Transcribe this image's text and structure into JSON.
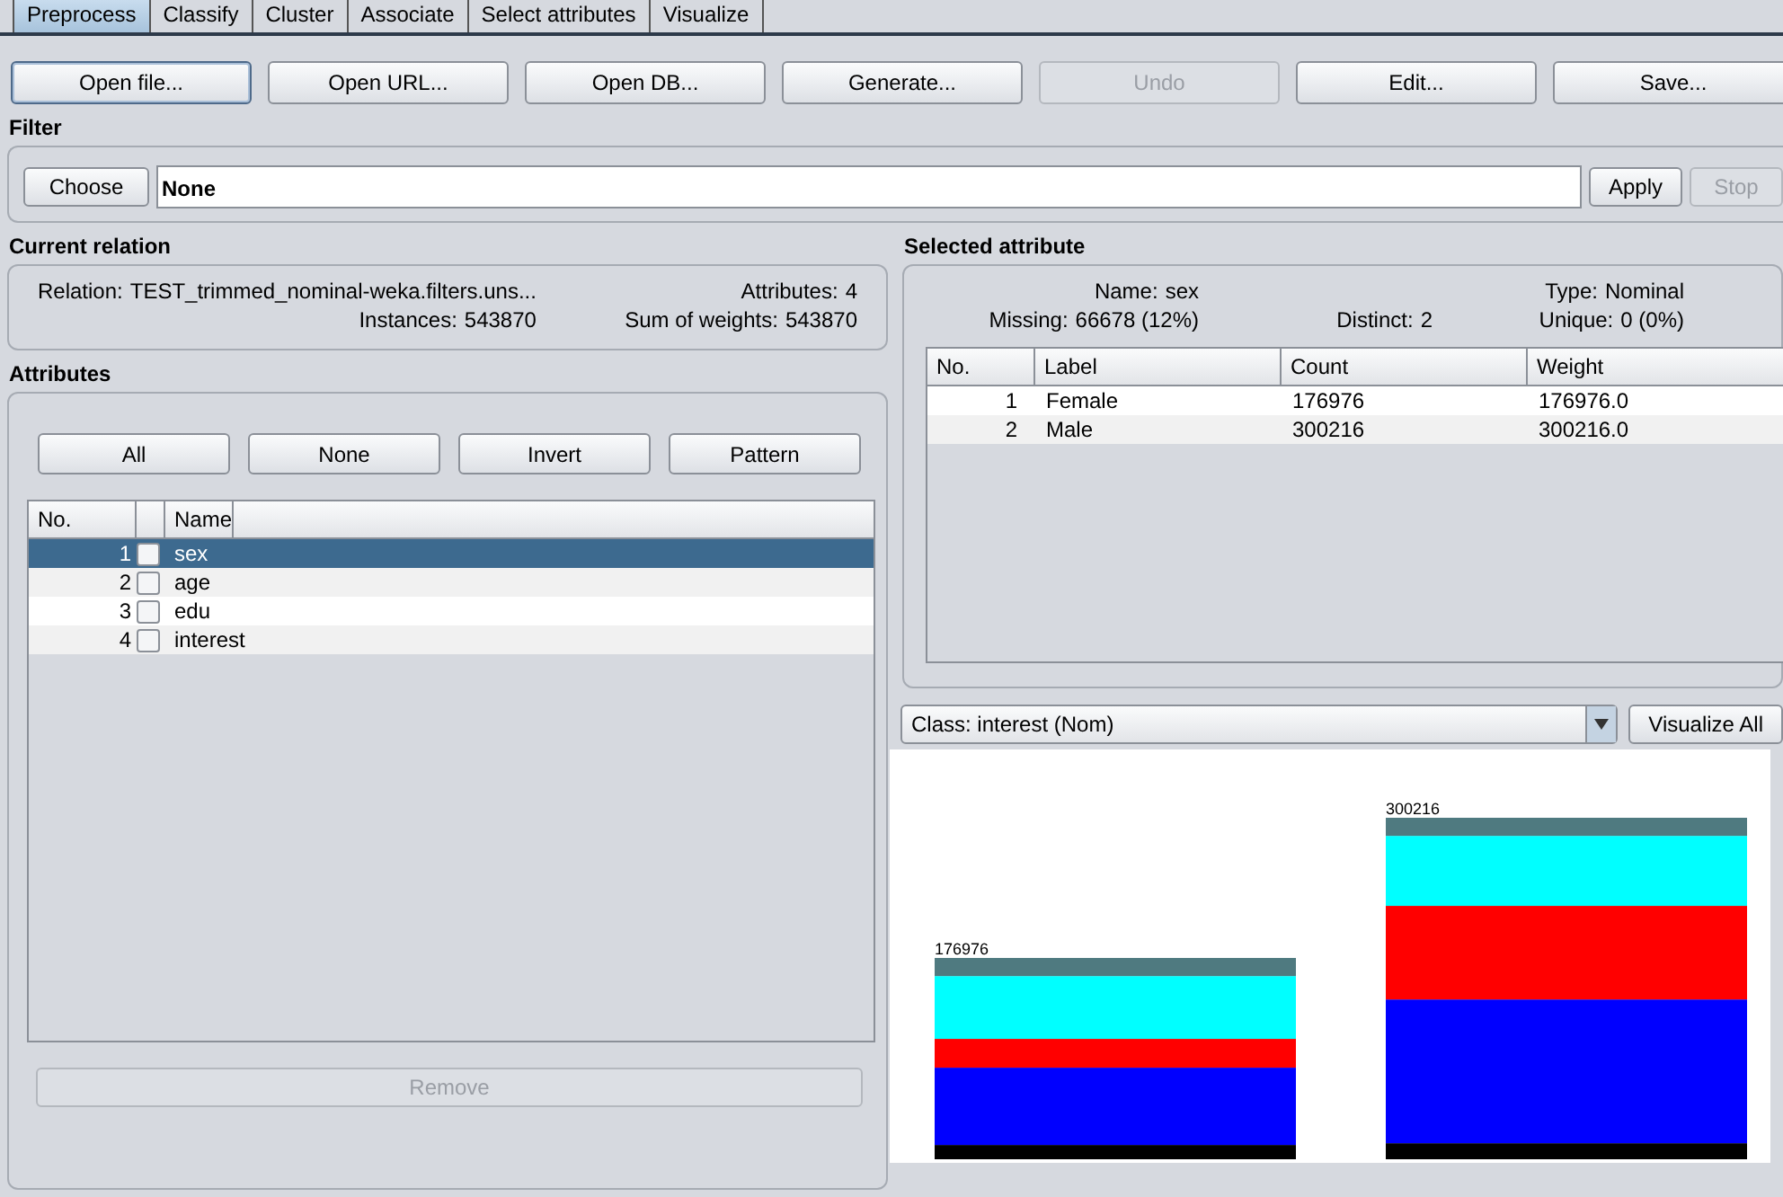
{
  "tabs": [
    {
      "label": "Preprocess",
      "selected": true
    },
    {
      "label": "Classify",
      "selected": false
    },
    {
      "label": "Cluster",
      "selected": false
    },
    {
      "label": "Associate",
      "selected": false
    },
    {
      "label": "Select attributes",
      "selected": false
    },
    {
      "label": "Visualize",
      "selected": false
    }
  ],
  "toolbar": [
    {
      "label": "Open file...",
      "disabled": false,
      "focused": true
    },
    {
      "label": "Open URL...",
      "disabled": false,
      "focused": false
    },
    {
      "label": "Open DB...",
      "disabled": false,
      "focused": false
    },
    {
      "label": "Generate...",
      "disabled": false,
      "focused": false
    },
    {
      "label": "Undo",
      "disabled": true,
      "focused": false
    },
    {
      "label": "Edit...",
      "disabled": false,
      "focused": false
    },
    {
      "label": "Save...",
      "disabled": false,
      "focused": false
    }
  ],
  "filter": {
    "title": "Filter",
    "choose": "Choose",
    "value": "None",
    "apply": {
      "label": "Apply",
      "disabled": false
    },
    "stop": {
      "label": "Stop",
      "disabled": true
    }
  },
  "current_relation": {
    "title": "Current relation",
    "relation_label": "Relation:",
    "relation": "TEST_trimmed_nominal-weka.filters.uns...",
    "instances_label": "Instances:",
    "instances": "543870",
    "attributes_label": "Attributes:",
    "attributes": "4",
    "weights_label": "Sum of weights:",
    "weights": "543870"
  },
  "attributes": {
    "title": "Attributes",
    "buttons": [
      "All",
      "None",
      "Invert",
      "Pattern"
    ],
    "columns": [
      "No.",
      "Name"
    ],
    "rows": [
      {
        "no": "1",
        "name": "sex",
        "checked": false,
        "selected": true
      },
      {
        "no": "2",
        "name": "age",
        "checked": false,
        "selected": false
      },
      {
        "no": "3",
        "name": "edu",
        "checked": false,
        "selected": false
      },
      {
        "no": "4",
        "name": "interest",
        "checked": false,
        "selected": false
      }
    ],
    "remove": {
      "label": "Remove",
      "disabled": true
    }
  },
  "selected_attribute": {
    "title": "Selected attribute",
    "name_label": "Name:",
    "name": "sex",
    "type_label": "Type:",
    "type": "Nominal",
    "missing_label": "Missing:",
    "missing": "66678 (12%)",
    "distinct_label": "Distinct:",
    "distinct": "2",
    "unique_label": "Unique:",
    "unique": "0 (0%)",
    "columns": [
      "No.",
      "Label",
      "Count",
      "Weight"
    ],
    "rows": [
      [
        "1",
        "Female",
        "176976",
        "176976.0"
      ],
      [
        "2",
        "Male",
        "300216",
        "300216.0"
      ]
    ]
  },
  "class_select": "Class: interest (Nom)",
  "visualize_all": "Visualize All",
  "histogram": {
    "bar_labels": [
      "176976",
      "300216"
    ]
  }
}
